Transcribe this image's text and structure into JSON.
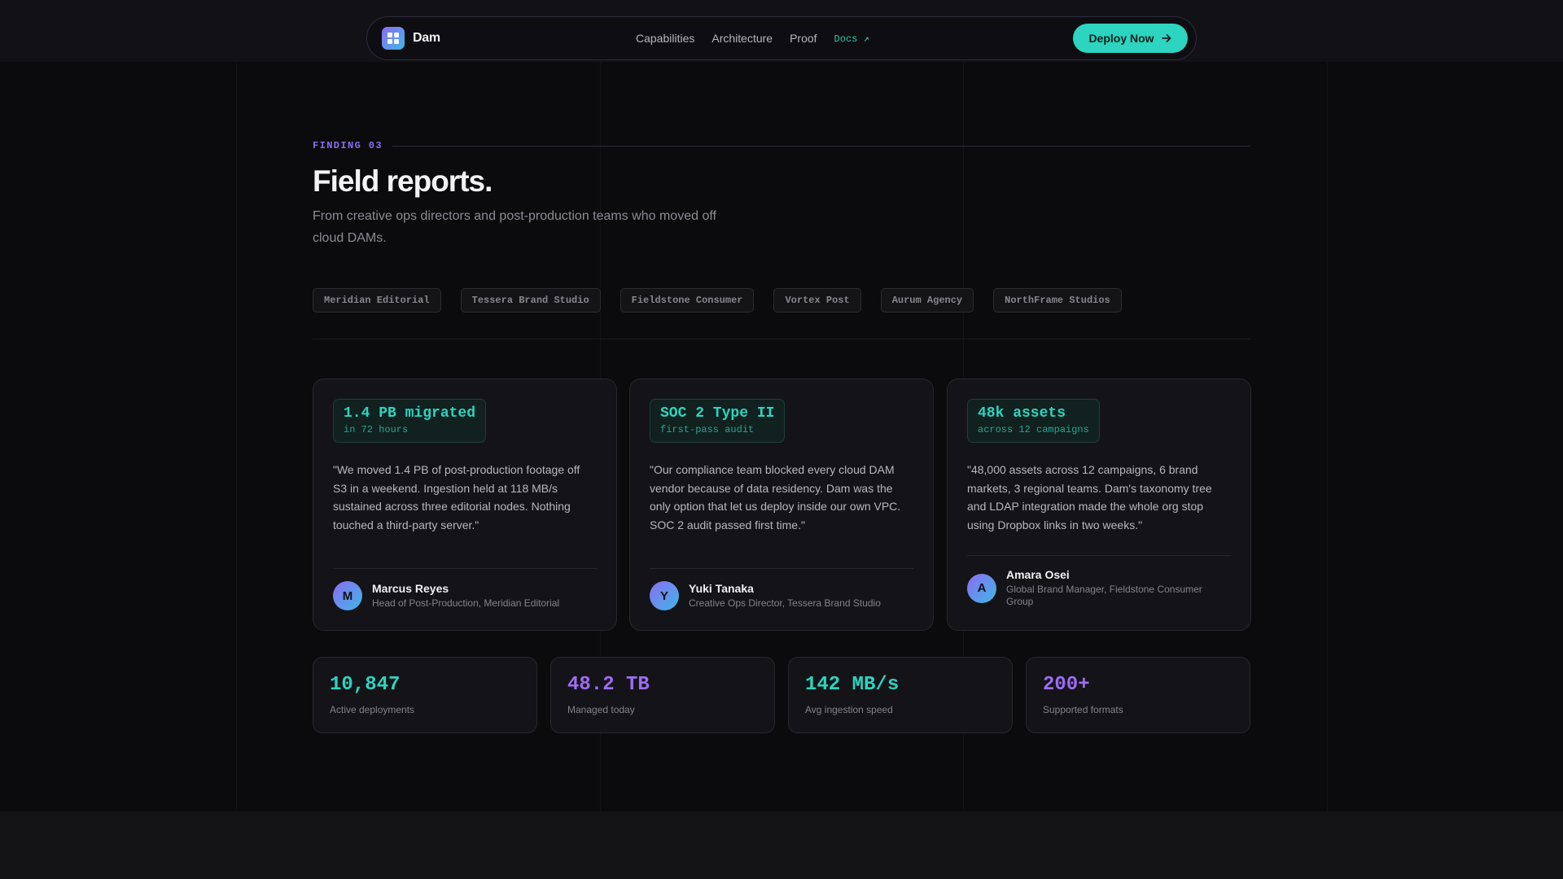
{
  "nav": {
    "brand": "Dam",
    "links": [
      "Capabilities",
      "Architecture",
      "Proof"
    ],
    "docs": "Docs ↗",
    "cta": "Deploy Now",
    "cta_icon": "arrow-right-icon"
  },
  "section": {
    "eyebrow": "FINDING 03",
    "title": "Field reports.",
    "subtitle": "From creative ops directors and post-production teams who moved off cloud DAMs."
  },
  "logos": [
    "Meridian Editorial",
    "Tessera Brand Studio",
    "Fieldstone Consumer",
    "Vortex Post",
    "Aurum Agency",
    "NorthFrame Studios"
  ],
  "testimonials": [
    {
      "metric": "1.4 PB migrated",
      "metric_sub": "in 72 hours",
      "quote": "\"We moved 1.4 PB of post-production footage off S3 in a weekend. Ingestion held at 118 MB/s sustained across three editorial nodes. Nothing touched a third-party server.\"",
      "avatar": "M",
      "name": "Marcus Reyes",
      "role": "Head of Post-Production, Meridian Editorial"
    },
    {
      "metric": "SOC 2 Type II",
      "metric_sub": "first-pass audit",
      "quote": "\"Our compliance team blocked every cloud DAM vendor because of data residency. Dam was the only option that let us deploy inside our own VPC. SOC 2 audit passed first time.\"",
      "avatar": "Y",
      "name": "Yuki Tanaka",
      "role": "Creative Ops Director, Tessera Brand Studio"
    },
    {
      "metric": "48k assets",
      "metric_sub": "across 12 campaigns",
      "quote": "\"48,000 assets across 12 campaigns, 6 brand markets, 3 regional teams. Dam's taxonomy tree and LDAP integration made the whole org stop using Dropbox links in two weeks.\"",
      "avatar": "A",
      "name": "Amara Osei",
      "role": "Global Brand Manager, Fieldstone Consumer Group"
    }
  ],
  "stats": [
    {
      "value": "10,847",
      "label": "Active deployments",
      "color": "#2dd4bf"
    },
    {
      "value": "48.2 TB",
      "label": "Managed today",
      "color": "#9d6cf5"
    },
    {
      "value": "142 MB/s",
      "label": "Avg ingestion speed",
      "color": "#2dd4bf"
    },
    {
      "value": "200+",
      "label": "Supported formats",
      "color": "#9d6cf5"
    }
  ],
  "colors": {
    "accent_teal": "#2dd4bf",
    "accent_violet": "#8b6cf2",
    "background": "#0b0b0d"
  }
}
